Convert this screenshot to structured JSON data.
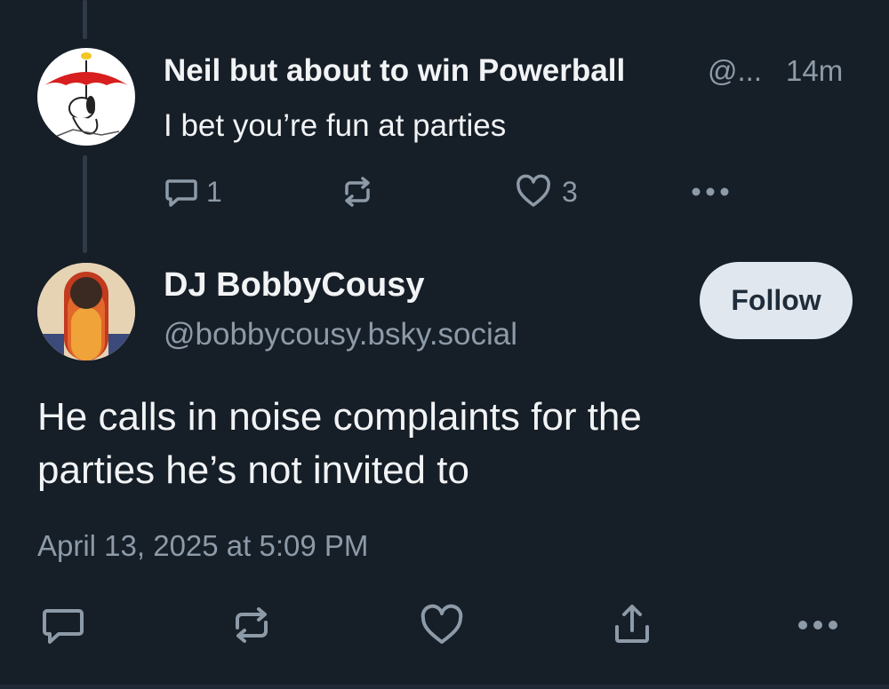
{
  "reply": {
    "display_name": "Neil but about to win Powerball",
    "handle": "@...",
    "time": "14m",
    "text": "I bet you’re fun at parties",
    "reply_count": "1",
    "like_count": "3"
  },
  "post": {
    "display_name": "DJ BobbyCousy",
    "handle": "@bobbycousy.bsky.social",
    "follow_label": "Follow",
    "text_line1": "He calls in noise complaints for the",
    "text_line2": "parties he’s not invited to",
    "timestamp": "April 13, 2025 at 5:09 PM"
  },
  "icons": {
    "reply": "speech-bubble-icon",
    "repost": "repost-arrows-icon",
    "like": "heart-icon",
    "share": "share-icon",
    "more": "ellipsis-icon"
  },
  "colors": {
    "background": "#161e27",
    "muted_text": "#8d9aa8",
    "follow_button_bg": "#e1e7ee",
    "follow_button_text": "#1f2c3a"
  }
}
